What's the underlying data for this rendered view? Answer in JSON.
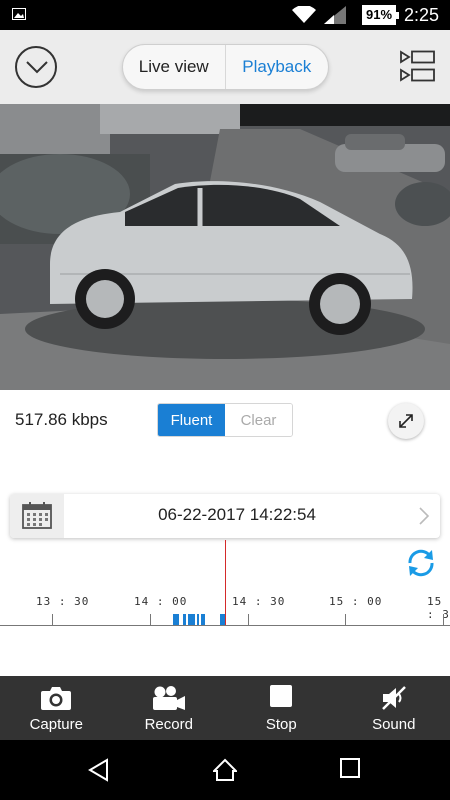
{
  "status_bar": {
    "battery": "91%",
    "time": "2:25"
  },
  "header": {
    "segments": [
      {
        "label": "Live view"
      },
      {
        "label": "Playback"
      }
    ],
    "active_segment": "Playback",
    "accent_color": "#1a7fd4"
  },
  "video": {
    "bitrate": "517.86 kbps"
  },
  "quality": {
    "options": [
      "Fluent",
      "Clear"
    ],
    "selected": "Fluent"
  },
  "date": {
    "value": "06-22-2017 14:22:54"
  },
  "timeline": {
    "labels": [
      "13:30",
      "14:00",
      "14:30",
      "15:00",
      "15:3"
    ],
    "cursor_color": "#d42a2a"
  },
  "toolbar": {
    "capture": "Capture",
    "record": "Record",
    "stop": "Stop",
    "sound": "Sound"
  },
  "icons": [
    "picture-icon",
    "wifi-icon",
    "signal-icon",
    "battery-icon",
    "chevron-down-icon",
    "list-view-icon",
    "fullscreen-icon",
    "calendar-icon",
    "chevron-right-icon",
    "refresh-icon",
    "camera-icon",
    "video-camera-icon",
    "stop-icon",
    "sound-muted-icon",
    "back-icon",
    "home-icon",
    "recents-icon"
  ]
}
